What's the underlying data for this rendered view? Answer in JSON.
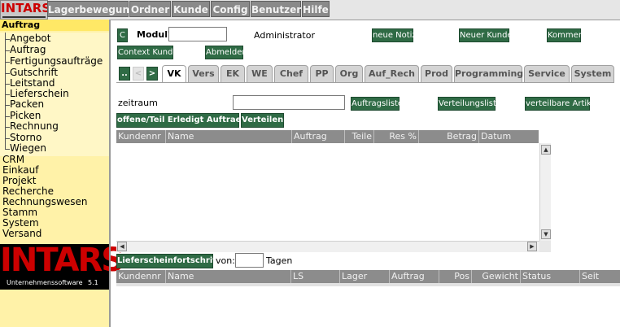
{
  "logo": {
    "small_text": "INTARS",
    "big_text": "INTARS",
    "tagline": "Unternehmenssoftware",
    "version": "5.1"
  },
  "menu": [
    "Lagerbewegung",
    "Ordner",
    "Kunde",
    "Config",
    "Benutzer",
    "Hilfe"
  ],
  "sidebar": {
    "header": "Auftrag",
    "sub_items": [
      "Angebot",
      "Auftrag",
      "Fertigungsaufträge",
      "Gutschrift",
      "Leitstand",
      "Lieferschein",
      "Packen",
      "Picken",
      "Rechnung",
      "Storno",
      "Wiegen"
    ],
    "main_items": [
      "CRM",
      "Einkauf",
      "Projekt",
      "Recherche",
      "Rechnungswesen",
      "Stamm",
      "System",
      "Versand"
    ]
  },
  "toolbar": {
    "c_button": "C",
    "modul_label": "Modul?",
    "modul_value": "",
    "user": "Administrator",
    "neue_notiz": "neue Notiz",
    "neuer_kunde": "Neuer Kunde",
    "kommen": "Kommen",
    "context_kunde": "Context Kunde",
    "abmelden": "Abmelden"
  },
  "nav": {
    "first": "..",
    "prev": "<",
    "next": ">"
  },
  "tabs": [
    "VK",
    "Vers",
    "EK",
    "WE",
    "Chef",
    "PP",
    "Org",
    "Auf_Rech",
    "Prod",
    "Programming",
    "Service",
    "System"
  ],
  "active_tab": "VK",
  "filter": {
    "zeitraum_label": "zeitraum",
    "zeitraum_value": "",
    "auftragsliste": "Auftragsliste",
    "verteilungsliste": "Verteilungsliste",
    "verteilbare_artikel": "verteilbare Artikel",
    "offene_btn": "offene/Teil Erledigt Auftraege",
    "verteilen_btn": "Verteilen"
  },
  "table1": {
    "columns": [
      "Kundennr",
      "Name",
      "Auftrag",
      "Teile",
      "Res %",
      "Betrag",
      "Datum"
    ]
  },
  "lieferschein": {
    "button": "Lieferscheinfortschritt",
    "von_label": "von:",
    "von_value": "",
    "tage_label": "Tagen"
  },
  "table2": {
    "columns": [
      "Kundennr",
      "Name",
      "LS",
      "Lager",
      "Auftrag",
      "Pos",
      "Gewicht",
      "Status",
      "Seit"
    ]
  },
  "colors": {
    "accent_green": "#2f6b45",
    "sidebar_bg": "#fff2a8",
    "brand_red": "#cc0000",
    "menu_gray": "#8a8a8a"
  }
}
